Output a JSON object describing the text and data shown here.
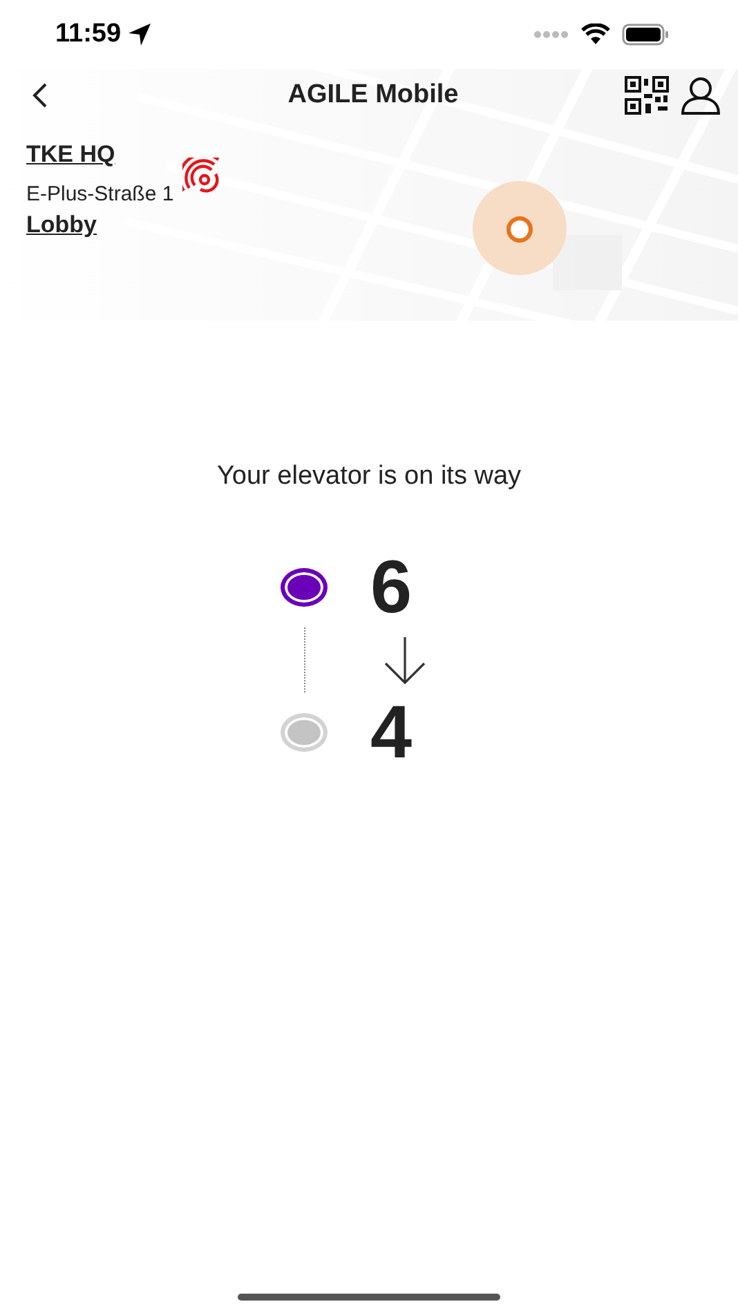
{
  "status_bar": {
    "time": "11:59"
  },
  "header": {
    "title": "AGILE Mobile"
  },
  "location": {
    "building": "TKE HQ",
    "address": "E-Plus-Straße 1",
    "floor": "Lobby"
  },
  "message": "Your elevator is on its way",
  "floors": [
    {
      "number": "6",
      "active": true
    },
    {
      "number": "4",
      "active": false
    }
  ]
}
